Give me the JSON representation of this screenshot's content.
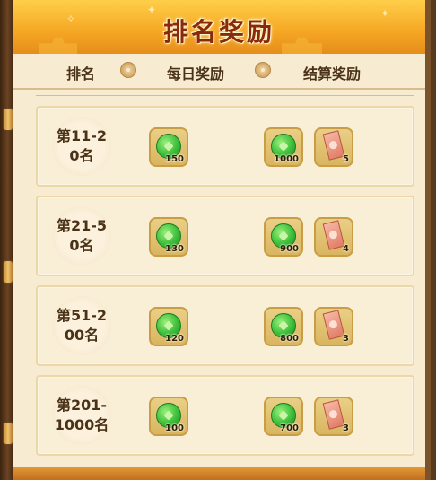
{
  "title": "排名奖励",
  "headers": {
    "rank": "排名",
    "daily": "每日奖励",
    "settle": "结算奖励"
  },
  "icons": {
    "daily_reward": "green-jade-coin-icon",
    "settle_item": "red-ticket-icon",
    "header_separator": "flower-icon"
  },
  "rows": [
    {
      "rank": "第11-20名",
      "daily": "150",
      "settle_coin": "1000",
      "settle_ticket": "5"
    },
    {
      "rank": "第21-50名",
      "daily": "130",
      "settle_coin": "900",
      "settle_ticket": "4"
    },
    {
      "rank": "第51-200名",
      "daily": "120",
      "settle_coin": "800",
      "settle_ticket": "3"
    },
    {
      "rank": "第201-1000名",
      "daily": "100",
      "settle_coin": "700",
      "settle_ticket": "3"
    }
  ]
}
